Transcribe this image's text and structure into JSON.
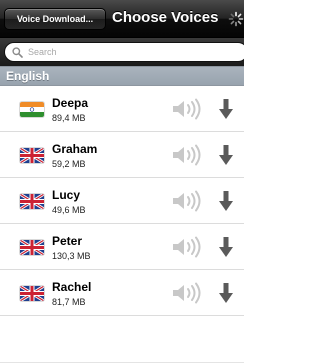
{
  "navbar": {
    "back_label": "Voice Download...",
    "title": "Choose Voices",
    "spinner_icon": "activity-spinner-icon",
    "bar_color": "#1a1a1a"
  },
  "search": {
    "placeholder": "Search",
    "icon": "search-icon"
  },
  "section": {
    "title": "English",
    "color": "#9ea8b3"
  },
  "voices": [
    {
      "name": "Deepa",
      "size": "89,4 MB",
      "flag": "india-flag-icon"
    },
    {
      "name": "Graham",
      "size": "59,2 MB",
      "flag": "uk-flag-icon"
    },
    {
      "name": "Lucy",
      "size": "49,6 MB",
      "flag": "uk-flag-icon"
    },
    {
      "name": "Peter",
      "size": "130,3 MB",
      "flag": "uk-flag-icon"
    },
    {
      "name": "Rachel",
      "size": "81,7 MB",
      "flag": "uk-flag-icon"
    }
  ],
  "row_icons": {
    "preview": "speaker-icon",
    "download": "download-arrow-icon",
    "icon_color": "#5a5a5a",
    "speaker_color": "#c8c8c8"
  }
}
